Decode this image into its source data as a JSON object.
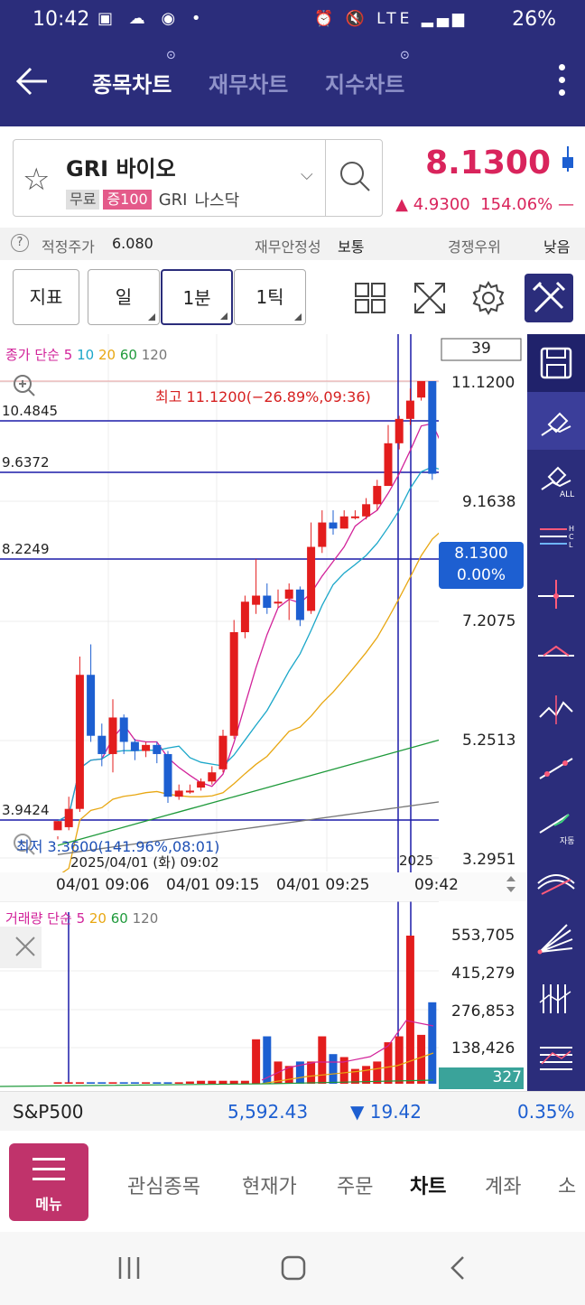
{
  "status_bar": {
    "time": "10:42",
    "battery": "26%",
    "network": "LTE"
  },
  "header": {
    "tabs": [
      {
        "label": "종목차트",
        "active": true
      },
      {
        "label": "재무차트",
        "active": false
      },
      {
        "label": "지수차트",
        "active": false
      }
    ]
  },
  "stock": {
    "name": "GRI 바이오",
    "badge_free": "무료",
    "badge_margin": "증100",
    "ticker": "GRI",
    "exchange": "나스닥",
    "price": "8.1300",
    "change": "▲ 4.9300",
    "change_pct": "154.06%"
  },
  "info": {
    "fair_label": "적정주가",
    "fair_value": "6.080",
    "stability_label": "재무안정성",
    "stability_value": "보통",
    "competition_label": "경쟁우위",
    "competition_value": "낮음"
  },
  "toolbar": {
    "indicator_label": "지표",
    "period_day": "일",
    "period_min": "1분",
    "period_tick": "1틱"
  },
  "chart": {
    "ma_title": "종가 단순",
    "ma_periods": [
      "5",
      "10",
      "20",
      "60",
      "120"
    ],
    "candle_count": "39",
    "high_note": "최고 11.1200(−26.89%,09:36)",
    "low_note": "최저 3.3600(141.96%,08:01)",
    "left_levels": [
      "10.4845",
      "9.6372",
      "8.2249",
      "3.9424"
    ],
    "price_ticks": [
      "11.1200",
      "9.1638",
      "7.2075",
      "5.2513",
      "3.2951"
    ],
    "last_price_label": "8.1300",
    "last_price_pct": "0.00%",
    "date_note": "2025/04/01 (화) 09:02",
    "time_ticks": [
      "04/01 09:06",
      "04/01 09:15",
      "04/01 09:25",
      "09:42"
    ],
    "time_overlap": "2025",
    "volume_title": "거래량 단순",
    "volume_periods": [
      "5",
      "20",
      "60",
      "120"
    ],
    "volume_ticks": [
      "553,705",
      "415,279",
      "276,853",
      "138,426"
    ],
    "last_volume": "327",
    "ma_colors": {
      "m5": "#d2239a",
      "m10": "#1ba7c9",
      "m20": "#e8a712",
      "m60": "#1f9a3b",
      "m120": "#777777"
    },
    "up_color": "#e31d1d",
    "down_color": "#1d5fd1"
  },
  "chart_data": {
    "type": "candlestick",
    "x": [
      "09:02",
      "09:03",
      "09:04",
      "09:05",
      "09:06",
      "09:07",
      "09:08",
      "09:09",
      "09:10",
      "09:11",
      "09:12",
      "09:13",
      "09:14",
      "09:15",
      "09:16",
      "09:17",
      "09:18",
      "09:19",
      "09:20",
      "09:21",
      "09:22",
      "09:23",
      "09:24",
      "09:25",
      "09:26",
      "09:27",
      "09:28",
      "09:29",
      "09:30",
      "09:31",
      "09:32",
      "09:33",
      "09:34",
      "09:35",
      "09:36",
      "09:37",
      "09:38",
      "09:39",
      "09:40"
    ],
    "ohlc": [
      [
        3.75,
        3.9,
        3.65,
        3.6
      ],
      [
        3.8,
        4.1,
        3.75,
        4.3
      ],
      [
        4.1,
        6.3,
        4.05,
        6.6
      ],
      [
        6.3,
        5.3,
        5.2,
        6.8
      ],
      [
        5.3,
        5.0,
        4.8,
        5.5
      ],
      [
        5.0,
        5.6,
        4.7,
        5.9
      ],
      [
        5.6,
        5.2,
        5.0,
        5.65
      ],
      [
        5.2,
        5.05,
        4.9,
        5.25
      ],
      [
        5.05,
        5.15,
        4.95,
        5.2
      ],
      [
        5.15,
        5.0,
        4.85,
        5.2
      ],
      [
        5.0,
        4.3,
        4.2,
        5.05
      ],
      [
        4.3,
        4.4,
        4.25,
        4.5
      ],
      [
        4.4,
        4.4,
        4.35,
        4.5
      ],
      [
        4.45,
        4.55,
        4.4,
        4.6
      ],
      [
        4.55,
        4.7,
        4.5,
        4.8
      ],
      [
        4.75,
        5.3,
        4.7,
        5.4
      ],
      [
        5.3,
        7.0,
        5.25,
        7.2
      ],
      [
        7.0,
        7.5,
        6.9,
        7.6
      ],
      [
        7.45,
        7.6,
        7.3,
        8.2
      ],
      [
        7.6,
        7.4,
        7.3,
        7.8
      ],
      [
        7.5,
        7.5,
        7.4,
        7.7
      ],
      [
        7.55,
        7.7,
        7.2,
        7.8
      ],
      [
        7.7,
        7.2,
        7.1,
        7.75
      ],
      [
        7.35,
        8.4,
        7.3,
        8.8
      ],
      [
        8.4,
        8.8,
        8.3,
        9.0
      ],
      [
        8.8,
        8.7,
        8.6,
        9.0
      ],
      [
        8.7,
        8.9,
        8.7,
        9.0
      ],
      [
        8.9,
        8.9,
        8.85,
        9.0
      ],
      [
        8.9,
        9.1,
        8.85,
        9.2
      ],
      [
        9.1,
        9.4,
        9.0,
        9.5
      ],
      [
        9.4,
        10.1,
        9.4,
        10.4
      ],
      [
        10.1,
        10.5,
        10.0,
        10.55
      ],
      [
        10.5,
        10.8,
        10.4,
        11.0
      ],
      [
        10.85,
        11.12,
        10.8,
        11.12
      ],
      [
        11.12,
        9.6,
        9.5,
        11.12
      ],
      [
        9.6,
        8.13,
        8.1,
        9.7
      ]
    ],
    "volume_max": 553705
  },
  "index_bar": {
    "name": "S&P500",
    "value": "5,592.43",
    "change": "▼ 19.42",
    "pct": "0.35%"
  },
  "bottom_nav": {
    "menu_label": "메뉴",
    "items": [
      "관심종목",
      "현재가",
      "주문",
      "차트",
      "계좌",
      "소"
    ],
    "active": "차트"
  }
}
